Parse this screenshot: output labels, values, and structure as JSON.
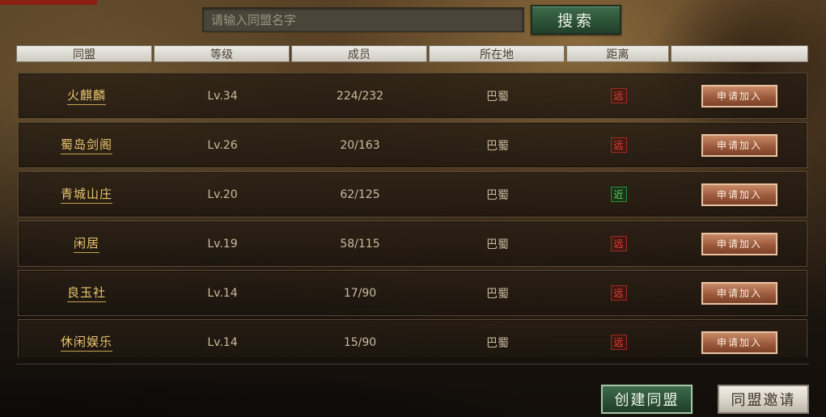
{
  "search": {
    "placeholder": "请输入同盟名字",
    "button_label": "搜索"
  },
  "columns": [
    "同盟",
    "等级",
    "成员",
    "所在地",
    "距离",
    ""
  ],
  "alliances": [
    {
      "name": "火麒麟",
      "level": "Lv.34",
      "members": "224/232",
      "location": "巴蜀",
      "distance": "远",
      "distance_type": "far",
      "action": "申请加入"
    },
    {
      "name": "蜀岛剑阁",
      "level": "Lv.26",
      "members": "20/163",
      "location": "巴蜀",
      "distance": "远",
      "distance_type": "far",
      "action": "申请加入"
    },
    {
      "name": "青城山庄",
      "level": "Lv.20",
      "members": "62/125",
      "location": "巴蜀",
      "distance": "近",
      "distance_type": "near",
      "action": "申请加入"
    },
    {
      "name": "闲居",
      "level": "Lv.19",
      "members": "58/115",
      "location": "巴蜀",
      "distance": "远",
      "distance_type": "far",
      "action": "申请加入"
    },
    {
      "name": "良玉社",
      "level": "Lv.14",
      "members": "17/90",
      "location": "巴蜀",
      "distance": "远",
      "distance_type": "far",
      "action": "申请加入"
    },
    {
      "name": "休闲娱乐",
      "level": "Lv.14",
      "members": "15/90",
      "location": "巴蜀",
      "distance": "远",
      "distance_type": "far",
      "action": "申请加入"
    }
  ],
  "footer": {
    "create_label": "创建同盟",
    "invite_label": "同盟邀请"
  },
  "colors": {
    "far": "#e24a3c",
    "near": "#5ed46a",
    "alliance_name": "#e8c56e"
  }
}
